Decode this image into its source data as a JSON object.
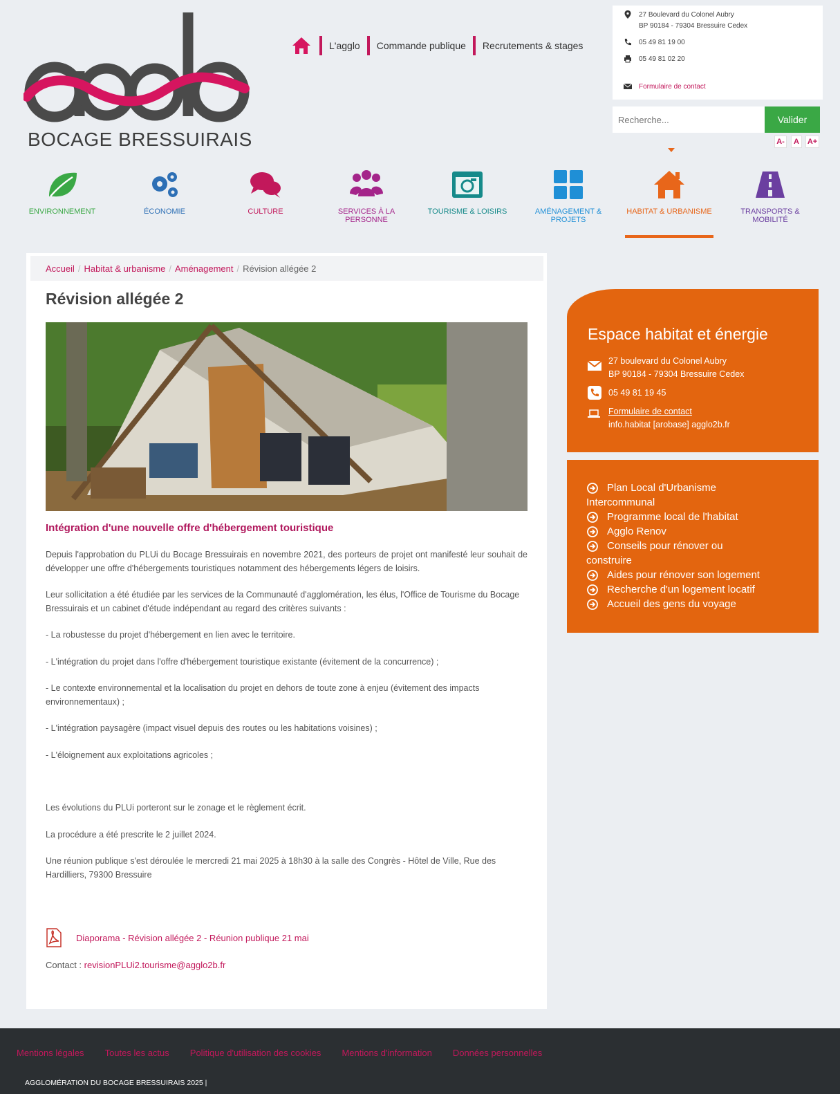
{
  "logo": {
    "text": "agglo",
    "subtitle": "BOCAGE BRESSUIRAIS"
  },
  "topnav": {
    "items": [
      "L'agglo",
      "Commande publique",
      "Recrutements & stages"
    ]
  },
  "contact": {
    "address1": "27 Boulevard du Colonel Aubry",
    "address2": "BP 90184 - 79304 Bressuire Cedex",
    "phone": "05 49 81 19 00",
    "fax": "05 49 81 02 20",
    "form": "Formulaire de contact"
  },
  "search": {
    "placeholder": "Recherche...",
    "button": "Valider"
  },
  "fontsize": {
    "smaller": "A-",
    "normal": "A",
    "larger": "A+"
  },
  "categories": [
    {
      "label": "ENVIRONNEMENT",
      "color": "#3aa845"
    },
    {
      "label": "ÉCONOMIE",
      "color": "#2d6fb5"
    },
    {
      "label": "CULTURE",
      "color": "#c2185b"
    },
    {
      "label": "SERVICES À LA PERSONNE",
      "color": "#a4248a"
    },
    {
      "label": "TOURISME & LOISIRS",
      "color": "#168a8a"
    },
    {
      "label": "AMÉNAGEMENT & PROJETS",
      "color": "#1f8fd6"
    },
    {
      "label": "HABITAT & URBANISME",
      "color": "#e8661a"
    },
    {
      "label": "TRANSPORTS & MOBILITÉ",
      "color": "#6b3fa0"
    }
  ],
  "breadcrumb": {
    "home": "Accueil",
    "level1": "Habitat & urbanisme",
    "level2": "Aménagement",
    "current": "Révision allégée 2"
  },
  "page": {
    "title": "Révision allégée 2",
    "subtitle": "Intégration d'une nouvelle offre d'hébergement touristique",
    "paragraphs": [
      "Depuis l'approbation du PLUi du Bocage Bressuirais en novembre 2021, des porteurs de projet ont manifesté leur souhait de développer une offre d'hébergements touristiques notamment des hébergements légers de loisirs.",
      "Leur sollicitation a été étudiée par les services de la Communauté d'agglomération, les élus, l'Office de Tourisme du Bocage Bressuirais et un cabinet d'étude indépendant au regard des critères suivants :",
      "- La robustesse du projet d'hébergement en lien avec le territoire.",
      "- L'intégration du projet dans l'offre d'hébergement touristique existante (évitement de la concurrence) ;",
      "- Le contexte environnemental et la localisation du projet en dehors de toute zone à enjeu (évitement des impacts environnementaux) ;",
      "- L'intégration paysagère (impact visuel depuis des routes ou les habitations voisines) ;",
      "- L'éloignement aux exploitations agricoles ;",
      "Les évolutions du PLUi porteront sur le zonage et le règlement écrit.",
      "La procédure a été prescrite le 2 juillet 2024.",
      "Une réunion publique s'est déroulée le mercredi 21 mai 2025 à 18h30 à la salle des Congrès - Hôtel de Ville, Rue des Hardilliers, 79300 Bressuire"
    ],
    "pdf_link": "Diaporama - Révision allégée 2 - Réunion publique 21 mai",
    "contact_label": "Contact : ",
    "contact_email": "revisionPLUi2.tourisme@agglo2b.fr"
  },
  "ehe": {
    "title": "Espace habitat et énergie",
    "addr1": "27 boulevard du Colonel Aubry",
    "addr2": "BP 90184 - 79304 Bressuire Cedex",
    "phone": "05 49 81 19 45",
    "form": "Formulaire de contact",
    "email": "info.habitat [arobase] agglo2b.fr"
  },
  "sidelinks": [
    "Plan Local d'Urbanisme",
    "Intercommunal",
    "Programme local de l'habitat",
    "Agglo Renov",
    "Conseils pour rénover ou",
    "construire",
    "Aides pour rénover son logement",
    "Recherche d'un logement locatif",
    "Accueil des gens du voyage"
  ],
  "footer": {
    "links": [
      "Mentions légales",
      "Toutes les actus",
      "Politique d'utilisation des cookies",
      "Mentions d'information",
      "Données personnelles"
    ],
    "copy": "AGGLOMÉRATION DU BOCAGE BRESSUIRAIS 2025 |"
  }
}
